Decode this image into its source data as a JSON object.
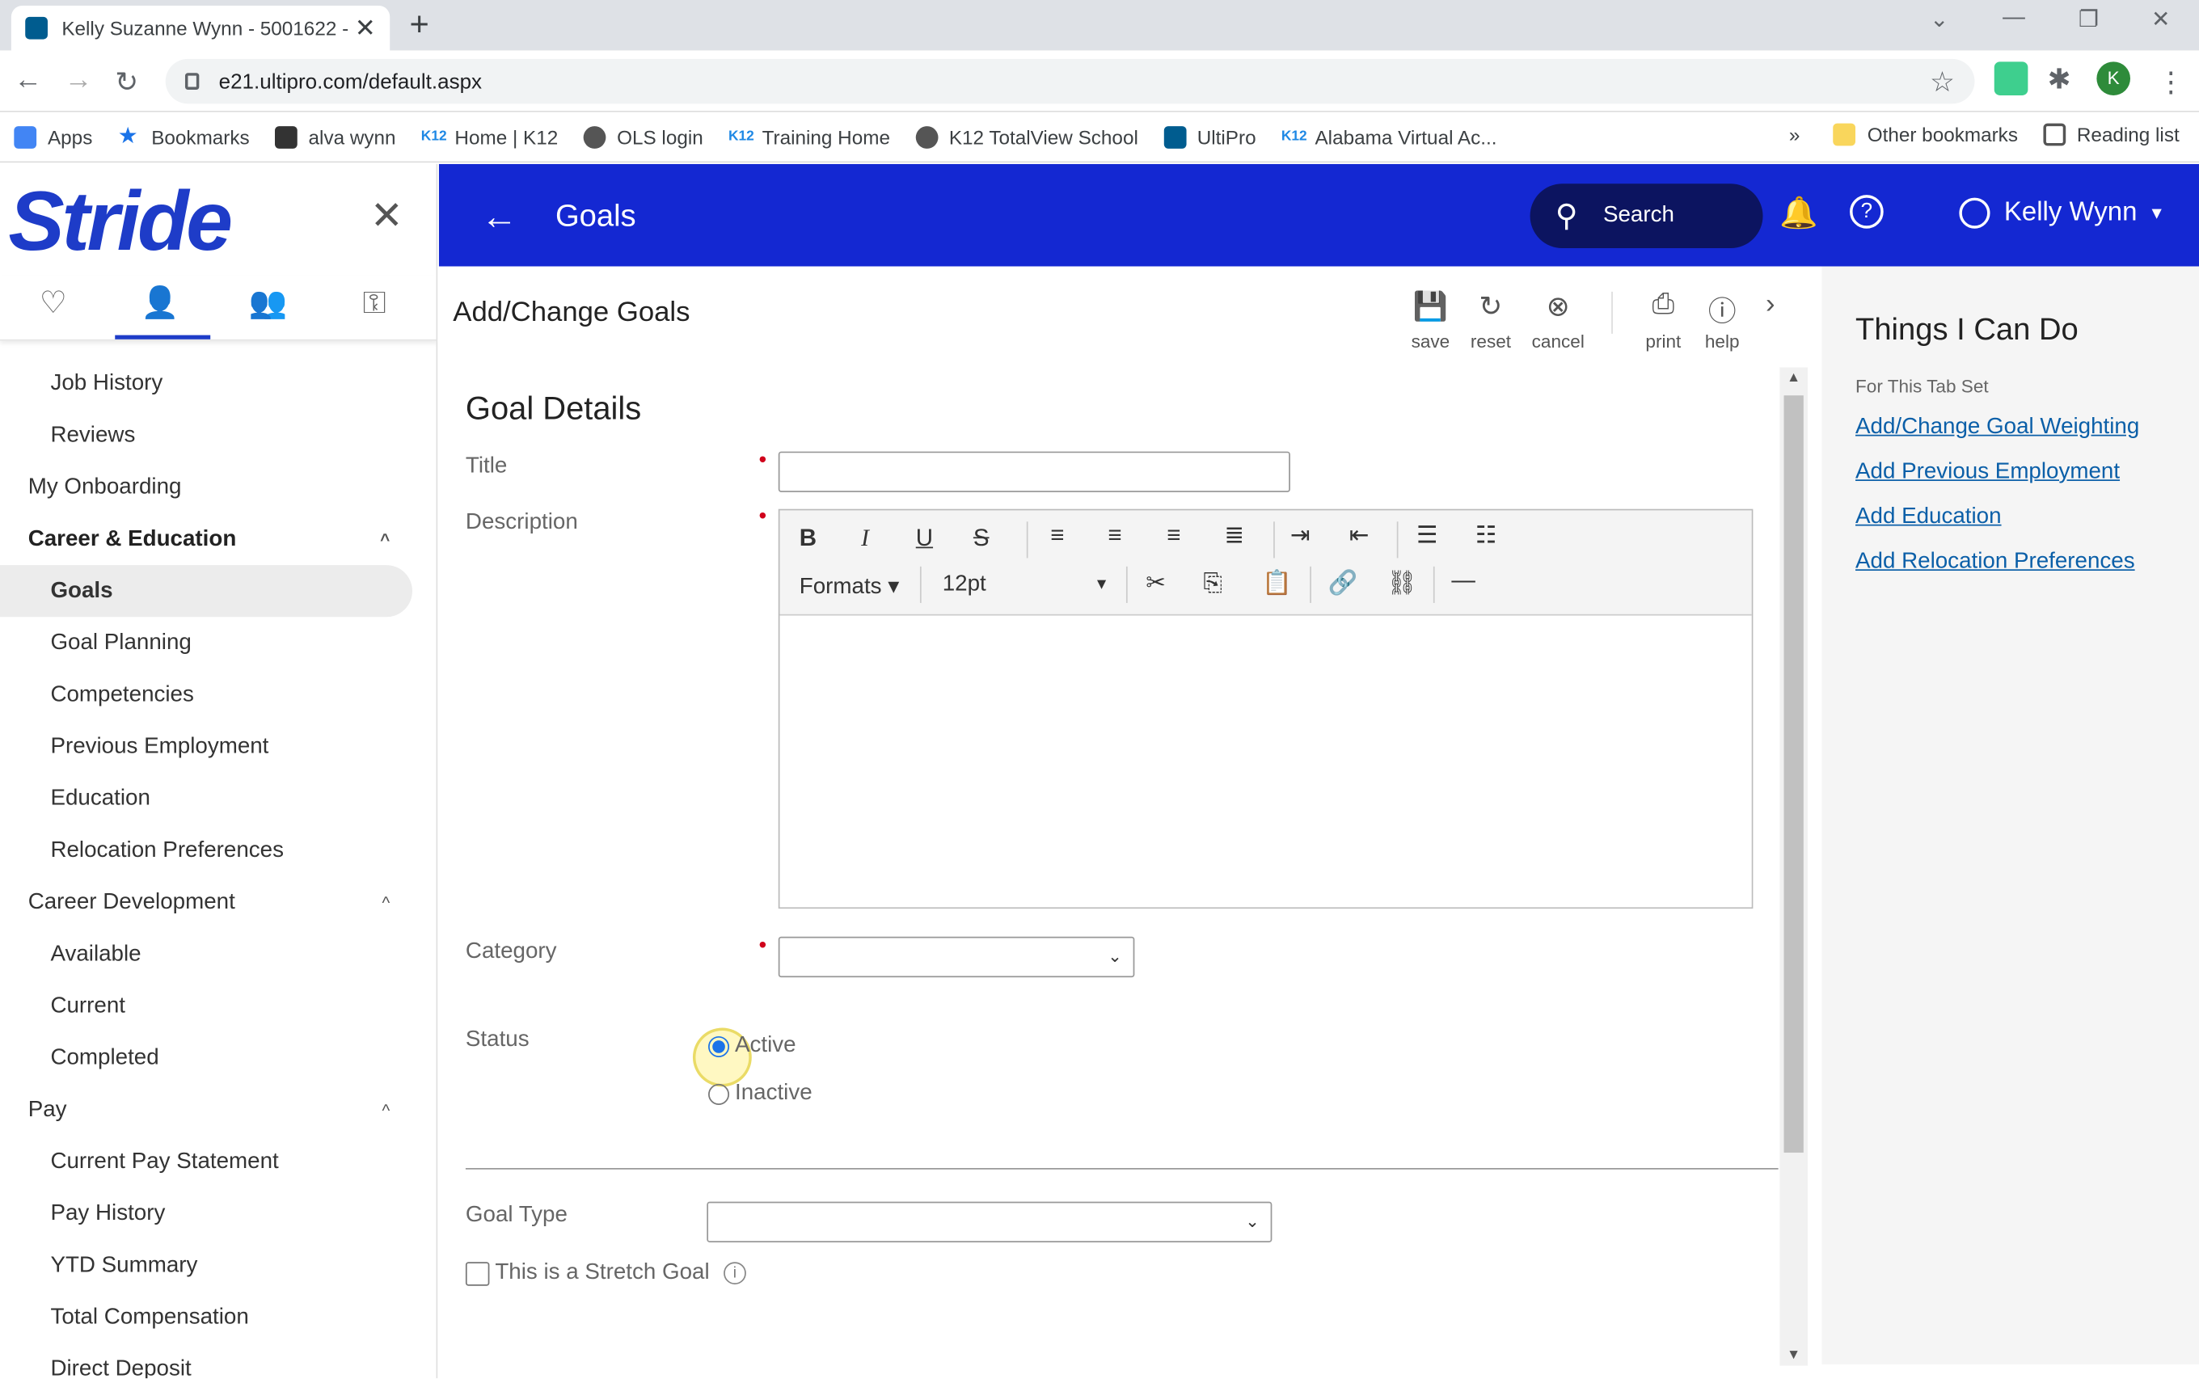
{
  "browser": {
    "tab_title": "Kelly Suzanne Wynn - 5001622 -",
    "url": "e21.ultipro.com/default.aspx",
    "profile_initial": "K",
    "bookmarks": [
      {
        "label": "Apps",
        "color": "#4285f4"
      },
      {
        "label": "Bookmarks",
        "color": "#1a73e8"
      },
      {
        "label": "alva wynn",
        "color": "#333333"
      },
      {
        "label": "Home | K12",
        "color": "#1e88e5"
      },
      {
        "label": "OLS login",
        "color": "#555555"
      },
      {
        "label": "Training Home",
        "color": "#1e88e5"
      },
      {
        "label": "K12 TotalView School",
        "color": "#555555"
      },
      {
        "label": "UltiPro",
        "color": "#005c8f"
      },
      {
        "label": "Alabama Virtual Ac...",
        "color": "#1e88e5"
      }
    ],
    "more_bookmarks": "»",
    "other_bookmarks": "Other bookmarks",
    "reading_list": "Reading list"
  },
  "sidebar": {
    "logo": "Stride",
    "items": [
      {
        "label": "Job History",
        "level": 2
      },
      {
        "label": "Reviews",
        "level": 2
      },
      {
        "label": "My Onboarding",
        "level": 1
      },
      {
        "label": "Career & Education",
        "level": 1,
        "bold": true,
        "expanded": true
      },
      {
        "label": "Goals",
        "level": 2,
        "selected": true
      },
      {
        "label": "Goal Planning",
        "level": 2
      },
      {
        "label": "Competencies",
        "level": 2
      },
      {
        "label": "Previous Employment",
        "level": 2
      },
      {
        "label": "Education",
        "level": 2
      },
      {
        "label": "Relocation Preferences",
        "level": 2
      },
      {
        "label": "Career Development",
        "level": 1,
        "expanded": true
      },
      {
        "label": "Available",
        "level": 2
      },
      {
        "label": "Current",
        "level": 2
      },
      {
        "label": "Completed",
        "level": 2
      },
      {
        "label": "Pay",
        "level": 1,
        "expanded": true
      },
      {
        "label": "Current Pay Statement",
        "level": 2
      },
      {
        "label": "Pay History",
        "level": 2
      },
      {
        "label": "YTD Summary",
        "level": 2
      },
      {
        "label": "Total Compensation",
        "level": 2
      },
      {
        "label": "Direct Deposit",
        "level": 2
      }
    ]
  },
  "header": {
    "title": "Goals",
    "search_label": "Search",
    "user_name": "Kelly Wynn",
    "brand_color": "#1428d2"
  },
  "main": {
    "page_title": "Add/Change Goals",
    "toolbar": {
      "save": "save",
      "reset": "reset",
      "cancel": "cancel",
      "print": "print",
      "help": "help"
    },
    "section_title": "Goal Details",
    "fields": {
      "title_label": "Title",
      "title_value": "",
      "description_label": "Description",
      "category_label": "Category",
      "category_value": "",
      "status_label": "Status",
      "status_options": [
        "Active",
        "Inactive"
      ],
      "status_selected": "Active",
      "goal_type_label": "Goal Type",
      "goal_type_value": "",
      "stretch_label": "This is a Stretch Goal",
      "stretch_checked": false
    },
    "editor": {
      "formats_label": "Formats",
      "font_size": "12pt"
    }
  },
  "right_panel": {
    "title": "Things I Can Do",
    "subtitle": "For This Tab Set",
    "links": [
      "Add/Change Goal Weighting",
      "Add Previous Employment",
      "Add Education",
      "Add Relocation Preferences"
    ]
  }
}
